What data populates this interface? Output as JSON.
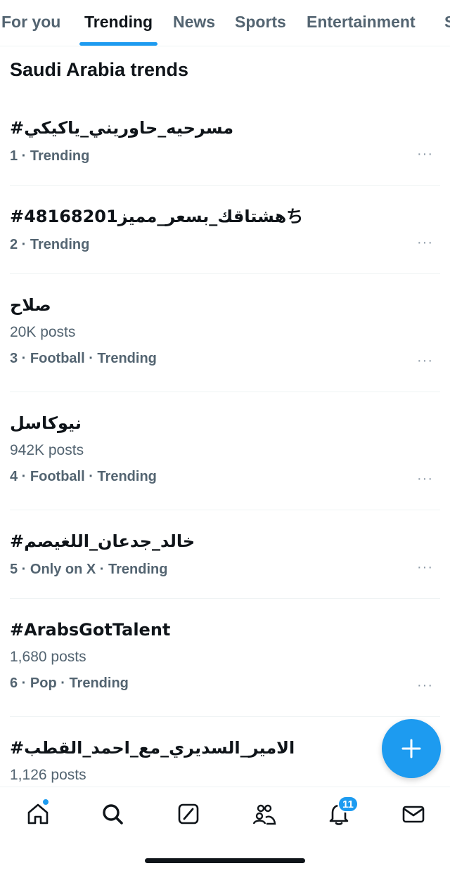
{
  "tabs": [
    {
      "label": "For you"
    },
    {
      "label": "Trending"
    },
    {
      "label": "News"
    },
    {
      "label": "Sports"
    },
    {
      "label": "Entertainment"
    },
    {
      "label": "S"
    }
  ],
  "active_tab": "Trending",
  "section_title": "Saudi Arabia trends",
  "trends": [
    {
      "topic": "#مسرحيه_حاوريني_ياكيكي",
      "posts": "",
      "meta": "1 · Trending"
    },
    {
      "topic": "#هشتاقك_بسعر_مميز48168201ち",
      "posts": "",
      "meta": "2 · Trending"
    },
    {
      "topic": "صلاح",
      "posts": "20K posts",
      "meta": "3 · Football · Trending"
    },
    {
      "topic": "نيوكاسل",
      "posts": "942K posts",
      "meta": "4 · Football · Trending"
    },
    {
      "topic": "#خالد_جدعان_اللغيصم",
      "posts": "",
      "meta": "5 · Only on X · Trending"
    },
    {
      "topic": "#ArabsGotTalent",
      "posts": "1,680 posts",
      "meta": "6 · Pop · Trending"
    },
    {
      "topic": "#الامير_السديري_مع_احمد_القطب",
      "posts": "1,126 posts",
      "meta": ""
    }
  ],
  "more_label": "···",
  "notifications_count": "11",
  "colors": {
    "accent": "#1d9bf0",
    "text": "#0f1419",
    "secondary": "#536471"
  },
  "nav_icons": [
    "home-icon",
    "search-icon",
    "grok-icon",
    "communities-icon",
    "notifications-icon",
    "messages-icon"
  ]
}
